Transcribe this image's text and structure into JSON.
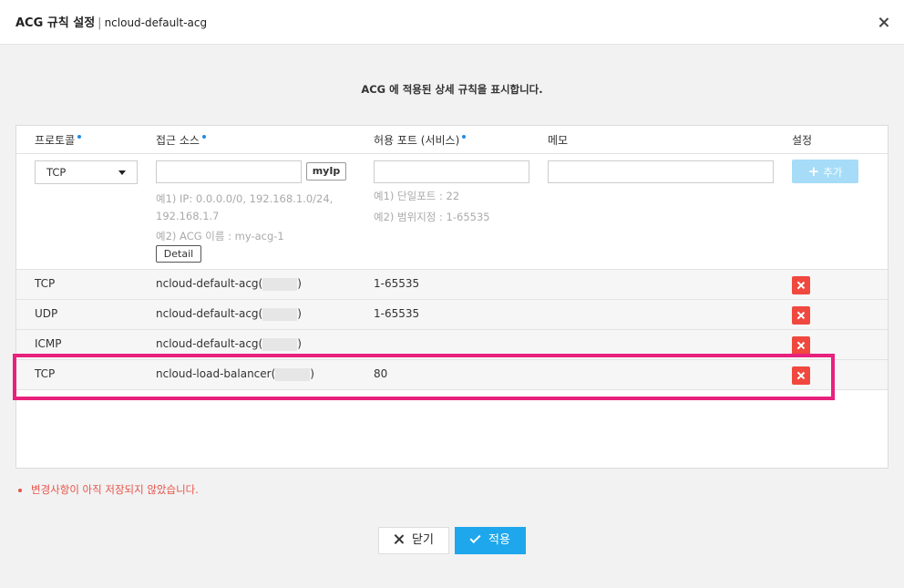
{
  "dialog": {
    "title": "ACG 규칙 설정",
    "separator": "|",
    "subtitle": "ncloud-default-acg"
  },
  "info_text": "ACG 에 적용된 상세 규칙을 표시합니다.",
  "columns": {
    "protocol": "프로토콜",
    "source": "접근 소스",
    "port": "허용 포트 (서비스)",
    "memo": "메모",
    "settings": "설정"
  },
  "input_row": {
    "protocol_selected": "TCP",
    "source_value": "",
    "port_value": "",
    "memo_value": "",
    "myip_label": "myIp",
    "source_hint_1a": "예1) IP: 0.0.0.0/0, 192.168.1.0/24,",
    "source_hint_1b": "192.168.1.7",
    "source_hint_2": "예2) ACG 이름 : my-acg-1",
    "detail_label": "Detail",
    "port_hint_1": "예1) 단일포트 : 22",
    "port_hint_2": "예2) 범위지정 : 1-65535",
    "add_label": "추가"
  },
  "rules": [
    {
      "protocol": "TCP",
      "source_name": "ncloud-default-acg(",
      "source_close": ")",
      "port": "1-65535"
    },
    {
      "protocol": "UDP",
      "source_name": "ncloud-default-acg(",
      "source_close": ")",
      "port": "1-65535"
    },
    {
      "protocol": "ICMP",
      "source_name": "ncloud-default-acg(",
      "source_close": ")",
      "port": ""
    },
    {
      "protocol": "TCP",
      "source_name": "ncloud-load-balancer(",
      "source_close": ")",
      "port": "80"
    }
  ],
  "warning": "변경사항이 아직 저장되지 않았습니다.",
  "buttons": {
    "close": "닫기",
    "apply": "적용"
  },
  "colors": {
    "accent": "#1ea7ec",
    "delete": "#f0483e",
    "highlight": "#e8217c",
    "warning": "#e8534a"
  }
}
